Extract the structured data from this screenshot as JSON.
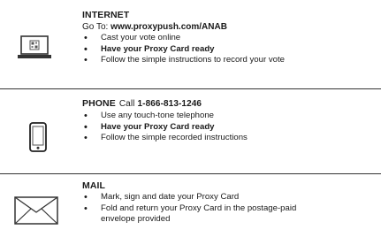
{
  "internet": {
    "heading": "INTERNET",
    "goto_prefix": "Go To: ",
    "url": "www.proxypush.com/ANAB",
    "bullets": [
      "Cast your vote online",
      "Have your Proxy Card ready",
      "Follow the simple instructions to record your vote"
    ],
    "icon": "laptop-qr-icon"
  },
  "phone": {
    "heading": "PHONE",
    "call_label": "Call",
    "number": "1-866-813-1246",
    "bullets": [
      "Use any touch-tone telephone",
      "Have your Proxy Card ready",
      "Follow the simple recorded instructions"
    ],
    "icon": "mobile-phone-icon"
  },
  "mail": {
    "heading": "MAIL",
    "bullets": [
      "Mark, sign and date your Proxy Card",
      "Fold and return your Proxy Card in the postage-paid",
      "envelope provided"
    ],
    "icon": "envelope-icon"
  }
}
